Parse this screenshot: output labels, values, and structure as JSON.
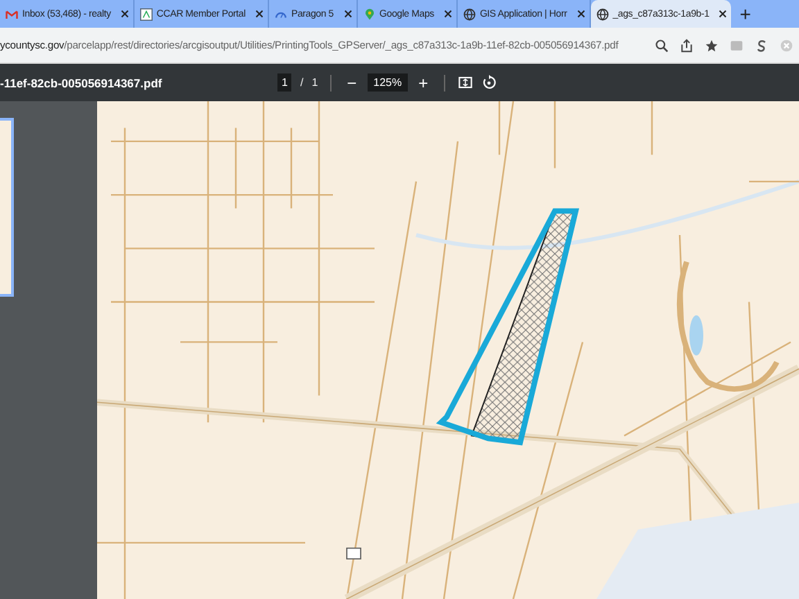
{
  "tabs": [
    {
      "title": "Inbox (53,468) - realty",
      "kind": "mail",
      "selected": false
    },
    {
      "title": "CCAR Member Portal",
      "kind": "portal",
      "selected": false
    },
    {
      "title": "Paragon 5",
      "kind": "gauge",
      "selected": false
    },
    {
      "title": "Google Maps",
      "kind": "pin",
      "selected": false
    },
    {
      "title": "GIS Application | Horr",
      "kind": "globe",
      "selected": false
    },
    {
      "title": "_ags_c87a313c-1a9b-1",
      "kind": "globe",
      "selected": true
    }
  ],
  "new_tab": "+",
  "address": {
    "domain": "ycountysc.gov",
    "path": "/parcelapp/rest/directories/arcgisoutput/Utilities/PrintingTools_GPServer/_ags_c87a313c-1a9b-11ef-82cb-005056914367.pdf"
  },
  "pdf_toolbar": {
    "file_name": "-11ef-82cb-005056914367.pdf",
    "page": "1",
    "separator": "/",
    "page_count": "1",
    "zoom_out": "−",
    "zoom": "125%",
    "zoom_in": "+"
  }
}
